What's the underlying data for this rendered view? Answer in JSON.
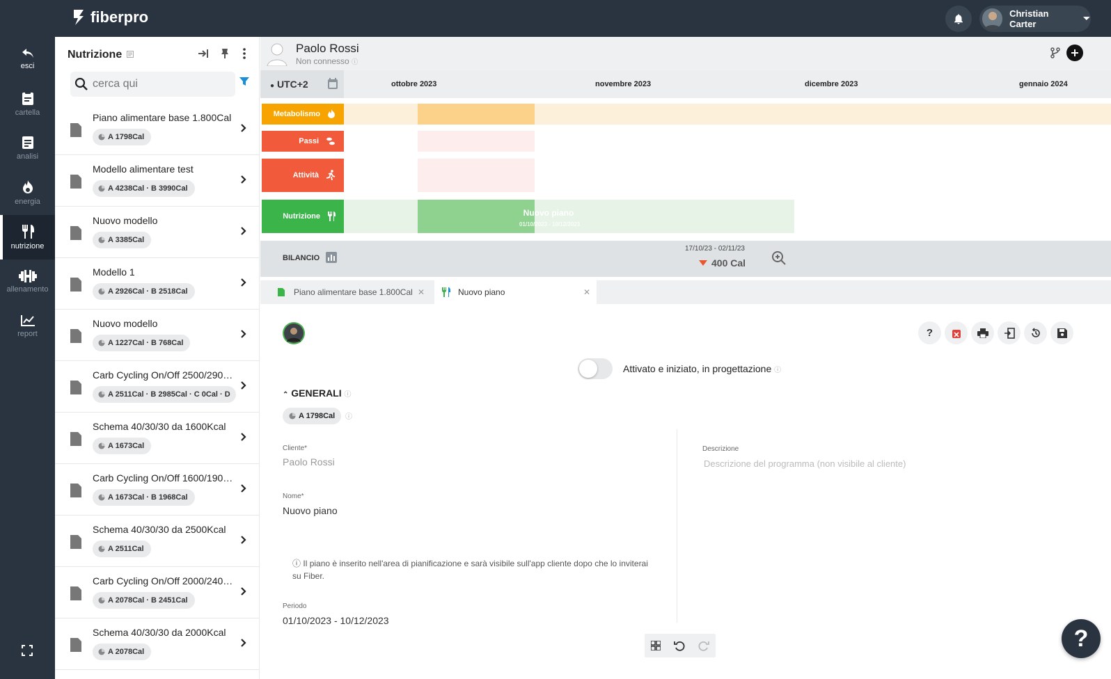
{
  "app": {
    "brand": "fiberpro",
    "user_name": "Christian Carter"
  },
  "nav": {
    "items": [
      {
        "label": "esci",
        "icon": "back-arrow-icon"
      },
      {
        "label": "cartella",
        "icon": "clipboard-icon"
      },
      {
        "label": "analisi",
        "icon": "document-icon"
      },
      {
        "label": "energia",
        "icon": "flame-icon"
      },
      {
        "label": "nutrizione",
        "icon": "fork-knife-icon"
      },
      {
        "label": "allenamento",
        "icon": "dumbbell-icon"
      },
      {
        "label": "report",
        "icon": "chart-line-icon"
      }
    ],
    "active": "nutrizione"
  },
  "panel": {
    "title": "Nutrizione",
    "search_placeholder": "cerca qui",
    "items": [
      {
        "name": "Piano alimentare base 1.800Cal",
        "badge": "A 1798Cal"
      },
      {
        "name": "Modello alimentare test",
        "badge": "A 4238Cal · B 3990Cal"
      },
      {
        "name": "Nuovo modello",
        "badge": "A 3385Cal"
      },
      {
        "name": "Modello 1",
        "badge": "A 2926Cal · B 2518Cal"
      },
      {
        "name": "Nuovo modello",
        "badge": "A 1227Cal · B 768Cal"
      },
      {
        "name": "Carb Cycling On/Off 2500/2900Kcal",
        "badge": "A 2511Cal · B 2985Cal · C 0Cal · D"
      },
      {
        "name": "Schema 40/30/30 da 1600Kcal",
        "badge": "A 1673Cal"
      },
      {
        "name": "Carb Cycling On/Off 1600/1900Kcal",
        "badge": "A 1673Cal · B 1968Cal"
      },
      {
        "name": "Schema 40/30/30 da 2500Kcal",
        "badge": "A 2511Cal"
      },
      {
        "name": "Carb Cycling On/Off 2000/2400Kcal",
        "badge": "A 2078Cal · B 2451Cal"
      },
      {
        "name": "Schema 40/30/30 da 2000Kcal",
        "badge": "A 2078Cal"
      }
    ]
  },
  "patient": {
    "name": "Paolo Rossi",
    "status": "Non connesso"
  },
  "timeline": {
    "timezone": "UTC+2",
    "months": [
      "ottobre 2023",
      "novembre 2023",
      "dicembre 2023",
      "gennaio 2024"
    ],
    "rows": [
      {
        "label": "Metabolismo",
        "color": "#f7a400"
      },
      {
        "label": "Passi",
        "color": "#f25a3c"
      },
      {
        "label": "Attività",
        "color": "#f25a3c"
      },
      {
        "label": "Nutrizione",
        "color": "#3bb54a"
      }
    ],
    "nutrition_bar_title": "Nuovo piano",
    "nutrition_bar_dates": "01/10/2023 - 10/12/2023"
  },
  "bilancio": {
    "label": "BILANCIO",
    "range": "17/10/23 - 02/11/23",
    "value": "400 Cal"
  },
  "tabs": [
    {
      "label": "Piano alimentare base 1.800Cal"
    },
    {
      "label": "Nuovo piano"
    }
  ],
  "form": {
    "status_text": "Attivato e iniziato, in progettazione",
    "section_title": "GENERALI",
    "badge": "A 1798Cal",
    "client_label": "Cliente*",
    "client_value": "Paolo Rossi",
    "name_label": "Nome*",
    "name_value": "Nuovo piano",
    "info_text": "Il piano è inserito nell'area di pianificazione e sarà visibile sull'app cliente dopo che lo inviterai su Fiber.",
    "period_label": "Periodo",
    "period_value": "01/10/2023 - 10/12/2023",
    "description_label": "Descrizione",
    "description_placeholder": "Descrizione del programma (non visibile al cliente)"
  }
}
